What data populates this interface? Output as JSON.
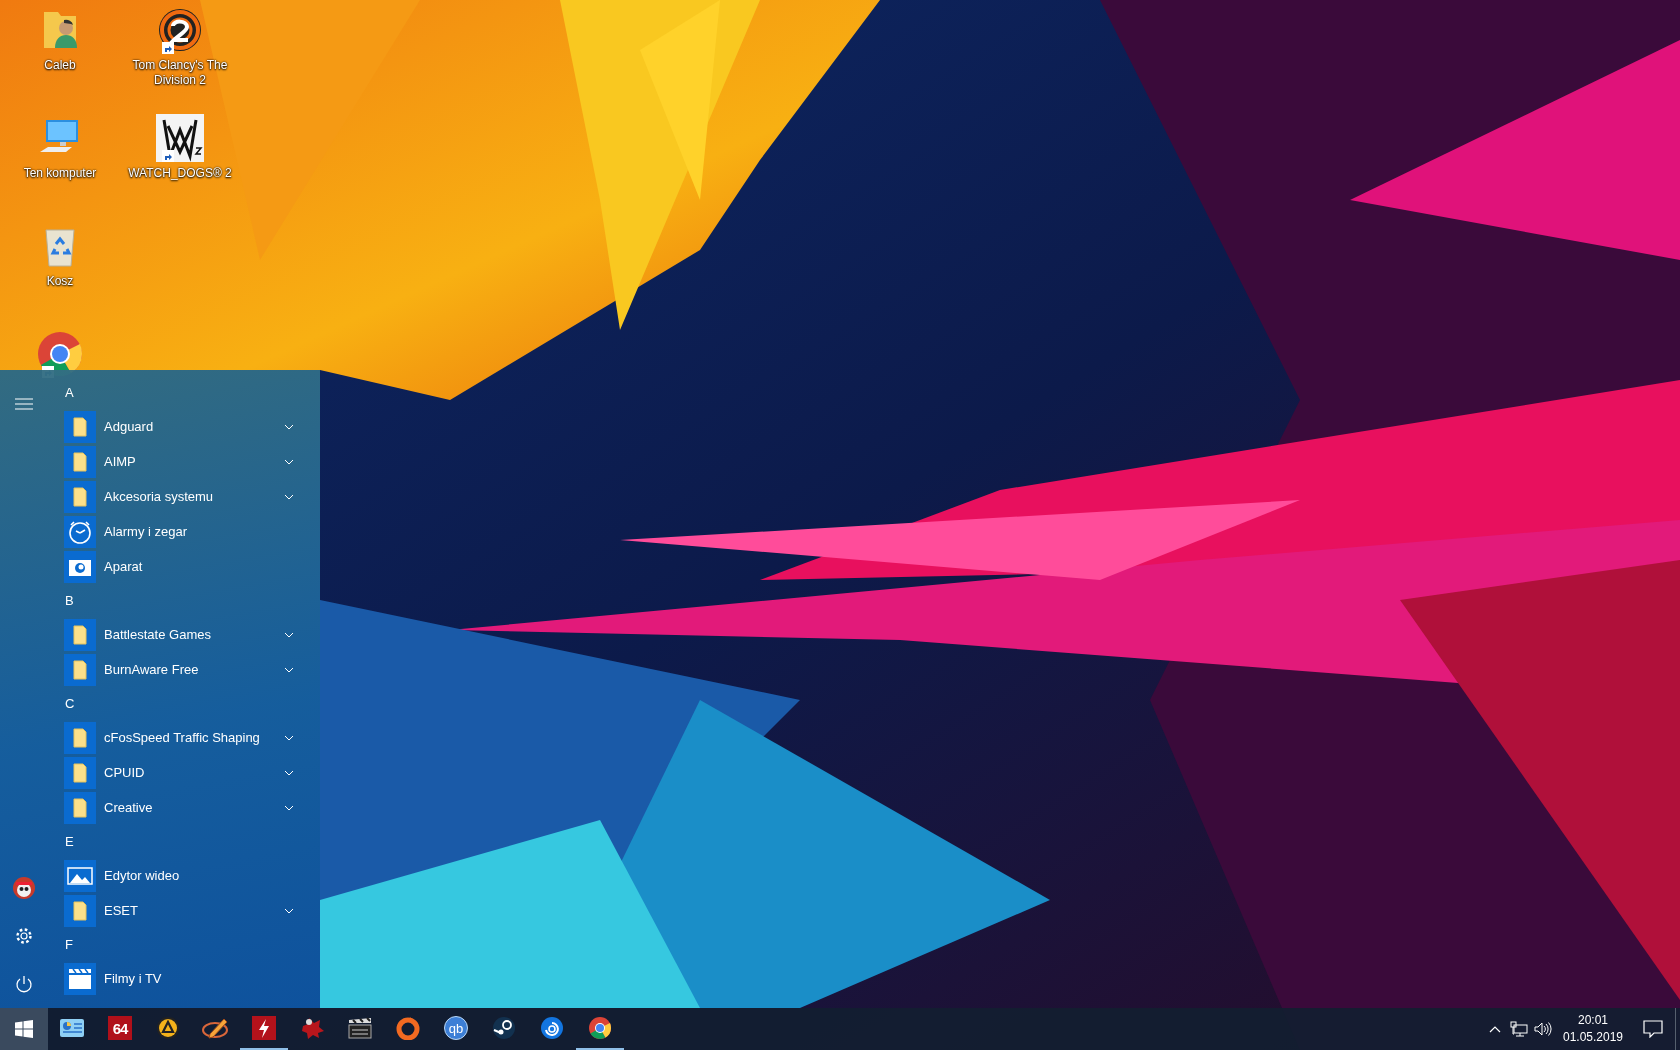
{
  "desktop_icons": [
    {
      "kind": "user-folder",
      "label": "Caleb"
    },
    {
      "kind": "computer",
      "label": "Ten komputer"
    },
    {
      "kind": "recycle-bin",
      "label": "Kosz"
    },
    {
      "kind": "browser",
      "shortcut": true
    },
    {
      "kind": "game-two",
      "label": "Tom Clancy's The Division 2",
      "shortcut": true
    },
    {
      "kind": "game-mask",
      "label": "WATCH_DOGS® 2",
      "shortcut": true
    }
  ],
  "start_menu": {
    "groups": [
      {
        "letter": "A",
        "items": [
          {
            "kind": "folder",
            "label": "Adguard",
            "expandable": true
          },
          {
            "kind": "folder",
            "label": "AIMP",
            "expandable": true
          },
          {
            "kind": "folder",
            "label": "Akcesoria systemu",
            "expandable": true
          },
          {
            "kind": "clock",
            "label": "Alarmy i zegar",
            "expandable": false
          },
          {
            "kind": "camera",
            "label": "Aparat",
            "expandable": false
          }
        ]
      },
      {
        "letter": "B",
        "items": [
          {
            "kind": "folder",
            "label": "Battlestate Games",
            "expandable": true
          },
          {
            "kind": "folder",
            "label": "BurnAware Free",
            "expandable": true
          }
        ]
      },
      {
        "letter": "C",
        "items": [
          {
            "kind": "folder",
            "label": "cFosSpeed Traffic Shaping",
            "expandable": true
          },
          {
            "kind": "folder",
            "label": "CPUID",
            "expandable": true
          },
          {
            "kind": "folder",
            "label": "Creative",
            "expandable": true
          }
        ]
      },
      {
        "letter": "E",
        "items": [
          {
            "kind": "photo",
            "label": "Edytor wideo",
            "expandable": false
          },
          {
            "kind": "folder",
            "label": "ESET",
            "expandable": true
          }
        ]
      },
      {
        "letter": "F",
        "items": [
          {
            "kind": "film",
            "label": "Filmy i TV",
            "expandable": false
          }
        ]
      }
    ]
  },
  "taskbar": {
    "start_button": {
      "active": true
    },
    "apps": [
      {
        "kind": "control-panel",
        "running": false
      },
      {
        "kind": "red-tile",
        "text": "64",
        "running": false
      },
      {
        "kind": "ring-triangle",
        "running": false
      },
      {
        "kind": "pencil",
        "running": false
      },
      {
        "kind": "bolt",
        "running": true
      },
      {
        "kind": "splat",
        "running": false
      },
      {
        "kind": "clapper",
        "running": false
      },
      {
        "kind": "orange-ring",
        "running": false
      },
      {
        "kind": "blue-circle",
        "text": "qb",
        "running": false
      },
      {
        "kind": "steam",
        "running": false
      },
      {
        "kind": "swirl",
        "running": false
      },
      {
        "kind": "browser",
        "running": true
      }
    ],
    "tray": {
      "time": "20:01",
      "date": "01.05.2019"
    }
  }
}
